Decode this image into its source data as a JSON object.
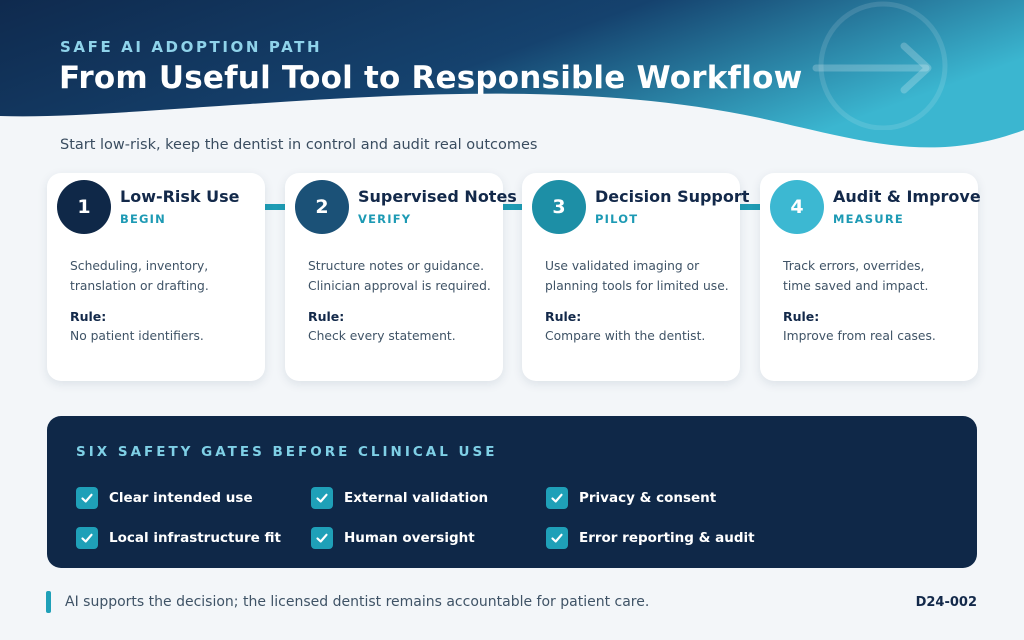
{
  "header": {
    "eyebrow": "SAFE AI ADOPTION PATH",
    "title": "From Useful Tool to Responsible Workflow",
    "subtitle": "Start low-risk, keep the dentist in control and audit real outcomes"
  },
  "steps": [
    {
      "number": "1",
      "title": "Low-Risk Use",
      "tag": "BEGIN",
      "desc_line1": "Scheduling, inventory,",
      "desc_line2": "translation or drafting.",
      "rule_label": "Rule:",
      "rule": "No patient identifiers.",
      "color": "#0f2848"
    },
    {
      "number": "2",
      "title": "Supervised Notes",
      "tag": "VERIFY",
      "desc_line1": "Structure notes or guidance.",
      "desc_line2": "Clinician approval is required.",
      "rule_label": "Rule:",
      "rule": "Check every statement.",
      "color": "#1b5177"
    },
    {
      "number": "3",
      "title": "Decision Support",
      "tag": "PILOT",
      "desc_line1": "Use validated imaging or",
      "desc_line2": "planning tools for limited use.",
      "rule_label": "Rule:",
      "rule": "Compare with the dentist.",
      "color": "#1d8fa6"
    },
    {
      "number": "4",
      "title": "Audit & Improve",
      "tag": "MEASURE",
      "desc_line1": "Track errors, overrides,",
      "desc_line2": "time saved and impact.",
      "rule_label": "Rule:",
      "rule": "Improve from real cases.",
      "color": "#3cb8d2"
    }
  ],
  "gates": {
    "title": "SIX SAFETY GATES BEFORE CLINICAL USE",
    "items": [
      "Clear intended use",
      "External validation",
      "Privacy & consent",
      "Local infrastructure fit",
      "Human oversight",
      "Error reporting & audit"
    ]
  },
  "footer": {
    "note": "AI supports the decision; the licensed dentist remains accountable for patient care.",
    "code": "D24-002"
  },
  "colors": {
    "navy": "#0f2848",
    "accent": "#1fa0b8",
    "eyebrow": "#8fd3ea"
  },
  "icons": {
    "decor": "arrow-right-icon",
    "gate": "check-icon"
  }
}
